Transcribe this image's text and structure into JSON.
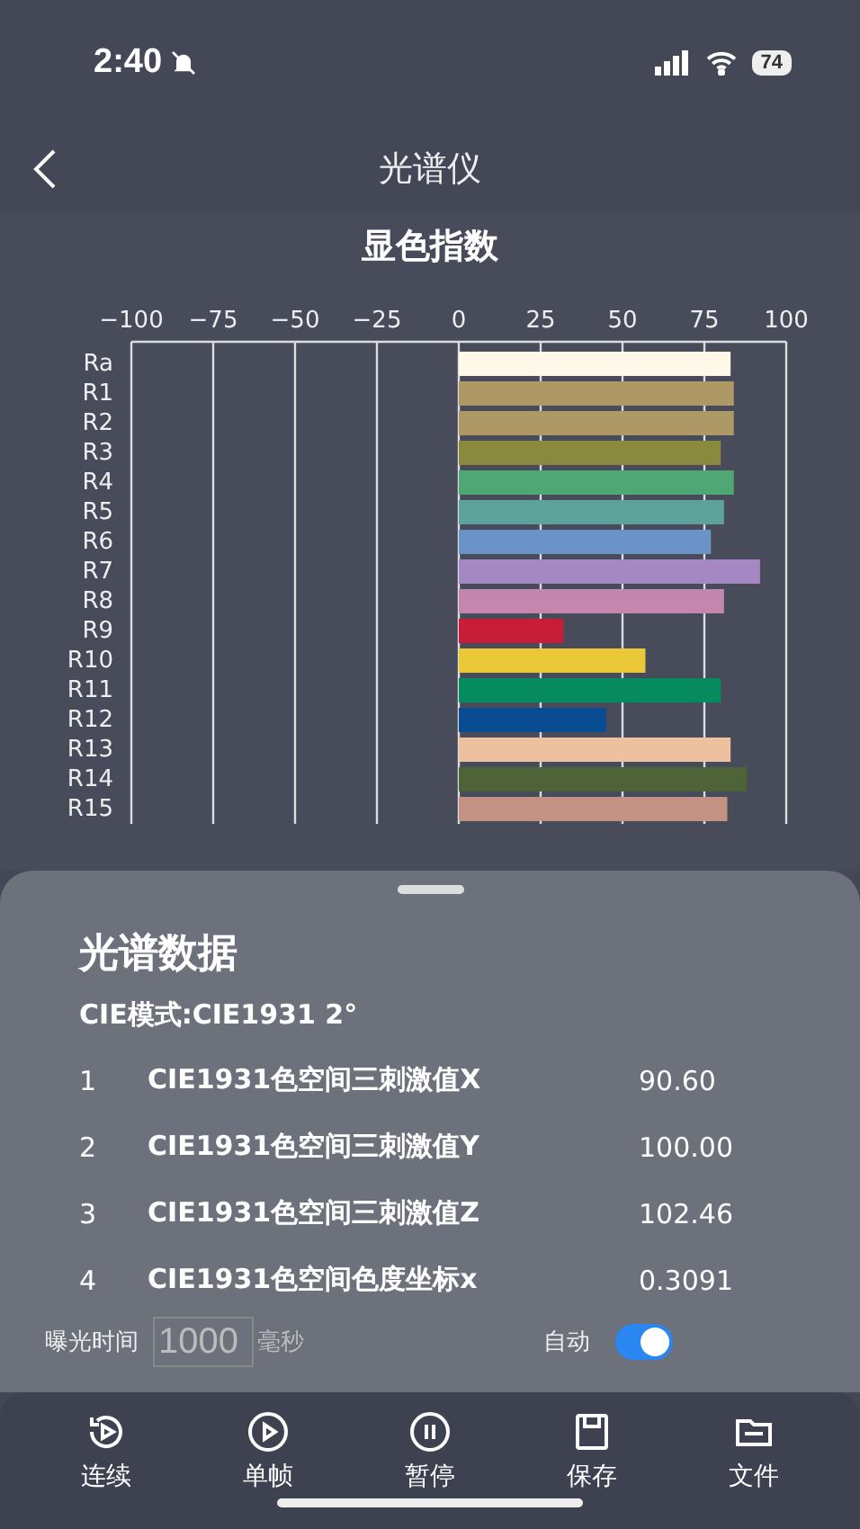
{
  "status_bar": {
    "time": "2:40",
    "silent": true,
    "battery": "74"
  },
  "nav": {
    "title": "光谱仪"
  },
  "chart_section": {
    "title": "显色指数",
    "chart_data": {
      "type": "bar",
      "orientation": "horizontal",
      "categories": [
        "Ra",
        "R1",
        "R2",
        "R3",
        "R4",
        "R5",
        "R6",
        "R7",
        "R8",
        "R9",
        "R10",
        "R11",
        "R12",
        "R13",
        "R14",
        "R15"
      ],
      "grid": true,
      "series": [
        {
          "values": [
            83,
            84,
            84,
            80,
            84,
            81,
            77,
            92,
            81,
            32,
            57,
            80,
            45,
            83,
            88,
            82
          ]
        }
      ],
      "colors": [
        "#fdf8e8",
        "#ae9865",
        "#ae9865",
        "#8a8a3e",
        "#4fa776",
        "#5da39c",
        "#6b93c8",
        "#a588c3",
        "#c486ae",
        "#c81d36",
        "#ebc838",
        "#058b5e",
        "#0a4c92",
        "#edc0a0",
        "#4e6338",
        "#c39282"
      ],
      "xlim": [
        -100,
        100
      ],
      "xticks": [
        {
          "value": -100,
          "label": "−100"
        },
        {
          "value": -75,
          "label": "−75"
        },
        {
          "value": -50,
          "label": "−50"
        },
        {
          "value": -25,
          "label": "−25"
        },
        0,
        25,
        50,
        75,
        100
      ]
    }
  },
  "sheet": {
    "title": "光谱数据",
    "mode": "CIE模式:CIE1931 2°",
    "rows": [
      {
        "index": "1",
        "name": "CIE1931色空间三刺激值X",
        "value": "90.60"
      },
      {
        "index": "2",
        "name": "CIE1931色空间三刺激值Y",
        "value": "100.00"
      },
      {
        "index": "3",
        "name": "CIE1931色空间三刺激值Z",
        "value": "102.46"
      },
      {
        "index": "4",
        "name": "CIE1931色空间色度坐标x",
        "value": "0.3091"
      }
    ],
    "exposure": {
      "label": "曝光时间",
      "value": "1000",
      "unit": "毫秒"
    },
    "auto": {
      "label": "自动",
      "on": true
    }
  },
  "toolbar": [
    {
      "kind": "continuous",
      "label": "连续"
    },
    {
      "kind": "single",
      "label": "单帧"
    },
    {
      "kind": "pause",
      "label": "暂停"
    },
    {
      "kind": "save",
      "label": "保存"
    },
    {
      "kind": "file",
      "label": "文件"
    }
  ]
}
